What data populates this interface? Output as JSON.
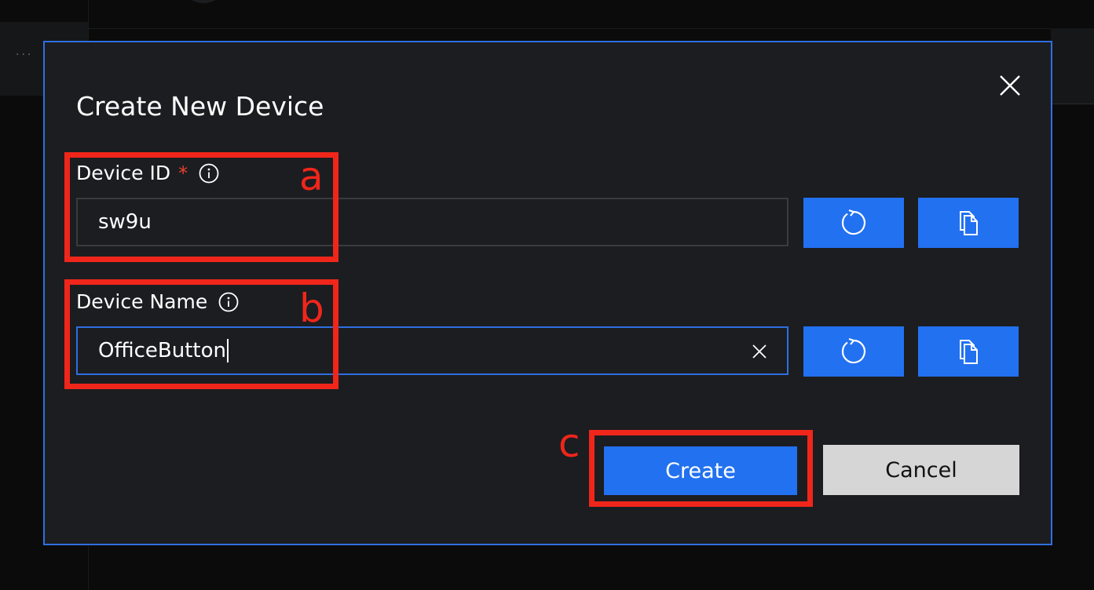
{
  "background": {
    "overflow_menu": "..."
  },
  "dialog": {
    "title": "Create New Device",
    "close_icon": "close-icon",
    "device_id": {
      "label": "Device ID",
      "required_marker": "*",
      "info_icon": "info-icon",
      "value": "sw9u",
      "regenerate_icon": "refresh-icon",
      "copy_icon": "copy-icon"
    },
    "device_name": {
      "label": "Device Name",
      "info_icon": "info-icon",
      "value": "OfficeButton",
      "clear_icon": "clear-icon",
      "regenerate_icon": "refresh-icon",
      "copy_icon": "copy-icon"
    },
    "create_label": "Create",
    "cancel_label": "Cancel"
  },
  "annotations": {
    "a": "a",
    "b": "b",
    "c": "c"
  },
  "colors": {
    "accent": "#2271f0",
    "dialog_bg": "#1c1d20",
    "annotation": "#f0261b",
    "required": "#e8432c",
    "cancel_bg": "#d6d6d6"
  }
}
